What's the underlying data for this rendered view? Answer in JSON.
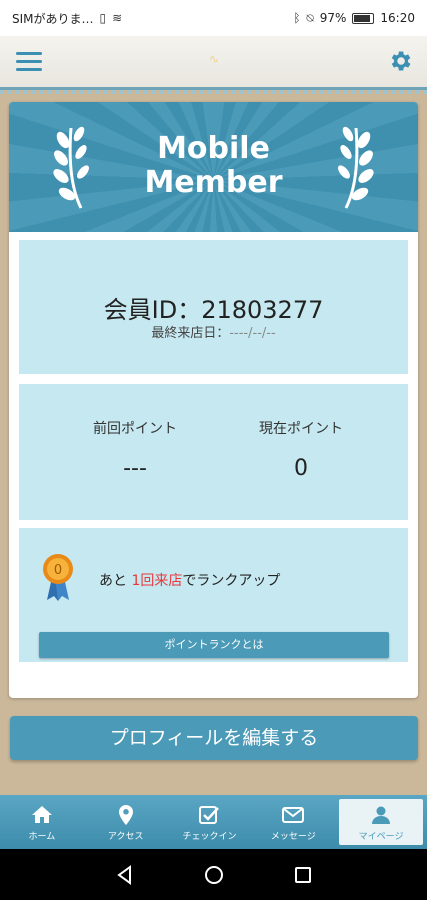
{
  "status_bar": {
    "carrier": "SIMがありま…",
    "battery": "97%",
    "time": "16:20"
  },
  "header": {
    "logo_text": "∿"
  },
  "banner": {
    "title_line1": "Mobile",
    "title_line2": "Member"
  },
  "member": {
    "id_text": "会員ID：21803277",
    "last_visit_label": "最終来店日：",
    "last_visit_value": "----/--/--"
  },
  "points": {
    "prev_label": "前回ポイント",
    "prev_value": "---",
    "cur_label": "現在ポイント",
    "cur_value": "0"
  },
  "rank": {
    "badge_value": "0",
    "msg_prefix": "あと",
    "msg_highlight": "1回来店",
    "msg_suffix": "でランクアップ",
    "button_label": "ポイントランクとは"
  },
  "profile_button_label": "プロフィールを編集する",
  "tabs": [
    {
      "label": "ホーム",
      "icon": "home-icon"
    },
    {
      "label": "アクセス",
      "icon": "map-pin-icon"
    },
    {
      "label": "チェックイン",
      "icon": "checkbox-icon"
    },
    {
      "label": "メッセージ",
      "icon": "mail-icon"
    },
    {
      "label": "マイページ",
      "icon": "user-icon"
    }
  ],
  "colors": {
    "primary": "#4a9ab8",
    "panel": "#c6e8f0",
    "highlight": "#e8383d",
    "background": "#cbb89a"
  }
}
